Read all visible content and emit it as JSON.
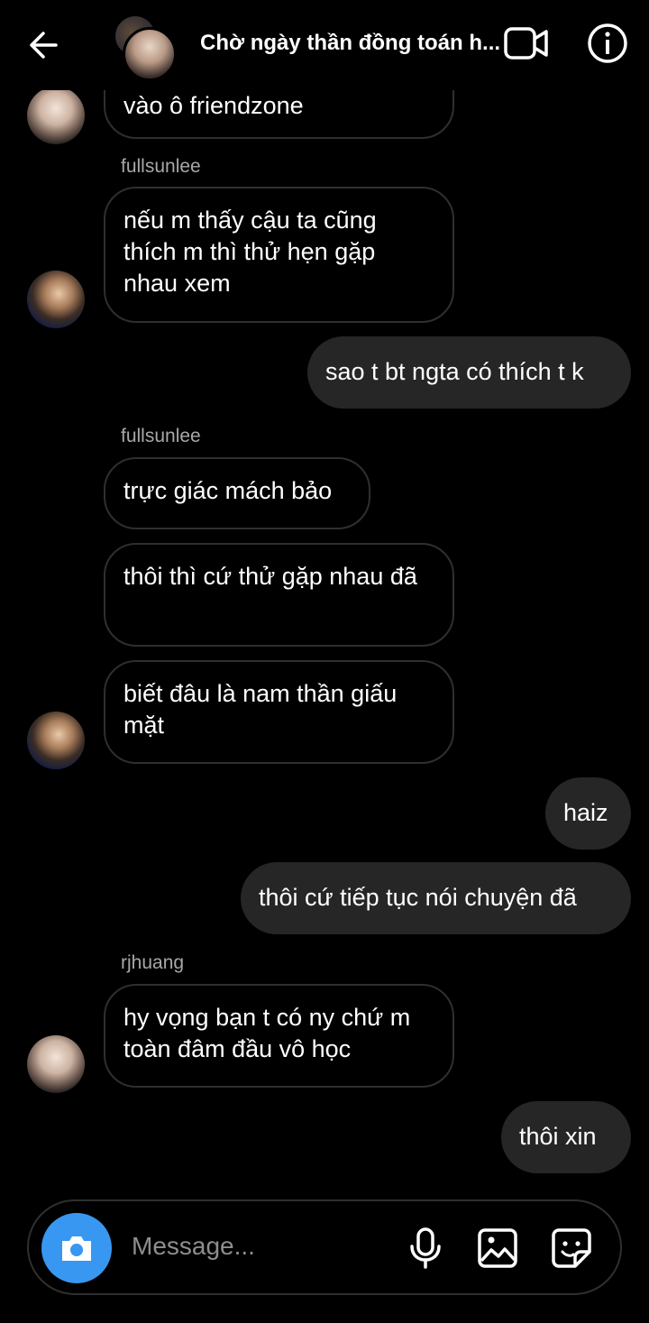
{
  "header": {
    "title": "Chờ ngày thần đồng toán h..."
  },
  "messages": {
    "m1": {
      "text": "vào ô friendzone"
    },
    "s1": "fullsunlee",
    "m2": {
      "text": "nếu m thấy cậu ta cũng thích m thì thử hẹn gặp nhau xem"
    },
    "m3": {
      "text": "sao t bt ngta có thích t k"
    },
    "s2": "fullsunlee",
    "m4": {
      "text": "trực giác mách bảo"
    },
    "m5": {
      "text": "thôi thì cứ thử gặp nhau đã"
    },
    "m6": {
      "text": "biết đâu là nam thần giấu mặt"
    },
    "m7": {
      "text": "haiz"
    },
    "m8": {
      "text": "thôi cứ tiếp tục nói chuyện đã"
    },
    "s3": "rjhuang",
    "m9": {
      "text": "hy vọng bạn t có ny chứ m toàn đâm đầu vô học"
    },
    "m10": {
      "text": "thôi xin"
    }
  },
  "composer": {
    "placeholder": "Message..."
  },
  "colors": {
    "accent": "#3897f0",
    "outgoing_bubble": "#262626",
    "incoming_border": "#2f2f2f"
  },
  "icons": [
    "back-arrow-icon",
    "video-call-icon",
    "info-icon",
    "camera-icon",
    "microphone-icon",
    "gallery-icon",
    "sticker-icon"
  ]
}
